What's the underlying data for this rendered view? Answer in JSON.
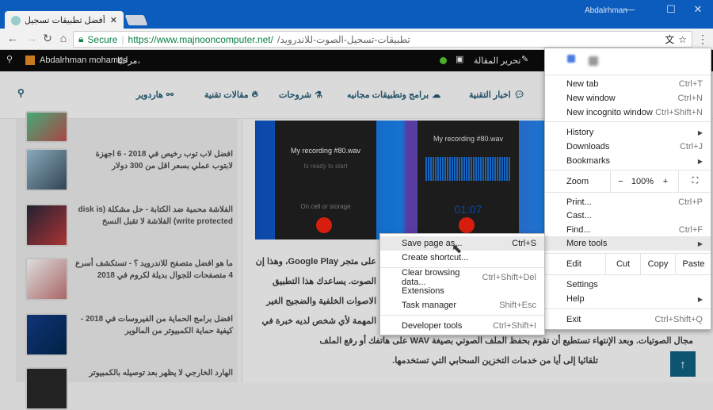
{
  "window": {
    "user": "Abdalrhman",
    "tab_title": "أفضل تطبيقات تسجيل الد..."
  },
  "omnibox": {
    "secure": "Secure",
    "url_host": "https://www.majnooncomputer.net/",
    "url_path": "تطبيقات-تسجيل-الصوت-للاندرويد/"
  },
  "topbar": {
    "user": "Abdalrhman mohamed",
    "greeting": "مرحبًا،",
    "edit_post": "تحرير المقالة"
  },
  "nav": {
    "items": [
      "اخبار التقنية",
      "برامج وتطبيقات مجانيه",
      "شروحات",
      "مقالات تقنية",
      "هاردوير"
    ]
  },
  "sidebar": {
    "posts": [
      "افضل لاب توب رخيص في 2018 - 6 اجهزة لابتوب عملي بسعر اقل من 300 دولار",
      "الفلاشة محمية ضد الكتابة - حل مشكلة (disk is write protected) الفلاشة لا تقبل النسخ",
      "ما هو افضل متصفح للاندرويد ؟ - تستكشف أسرع 4 متصفحات للجوال بديلة لكروم في 2018",
      "افضل برامج الحماية من الفيروسات في 2018 - كيفية حماية الكمبيوتر من المالوير",
      "الهارد الخارجي لا يظهر بعد توصيله بالكمبيوتر"
    ]
  },
  "hero": {
    "recording_name": "My recording #80.wav",
    "status": "Is ready to start",
    "storage": "On cell or storage",
    "timer": "01:07"
  },
  "article": {
    "lines": [
      "على متجر Google Play، وهذا إن",
      "الصوت. يساعدك هذا التطبيق",
      "الاصوات الخلفية والضجيج الغير",
      "المهمة لأي شخص لديه خبرة في",
      "مجال الصوتيات. وبعد الإنتهاء تستطيع أن تقوم بحفظ الملف الصوتي بصيغة WAV على هاتفك أو رفع الملف",
      "تلقائيا إلى أيا من خدمات التخزين السحابي التي تستخدمها."
    ]
  },
  "menu": {
    "new_tab": "New tab",
    "new_tab_sc": "Ctrl+T",
    "new_window": "New window",
    "new_window_sc": "Ctrl+N",
    "incognito": "New incognito window",
    "incognito_sc": "Ctrl+Shift+N",
    "history": "History",
    "downloads": "Downloads",
    "downloads_sc": "Ctrl+J",
    "bookmarks": "Bookmarks",
    "zoom": "Zoom",
    "zoom_minus": "−",
    "zoom_value": "100%",
    "zoom_plus": "+",
    "print": "Print...",
    "print_sc": "Ctrl+P",
    "cast": "Cast...",
    "find": "Find...",
    "find_sc": "Ctrl+F",
    "more_tools": "More tools",
    "edit": "Edit",
    "cut": "Cut",
    "copy": "Copy",
    "paste": "Paste",
    "settings": "Settings",
    "help": "Help",
    "exit": "Exit",
    "exit_sc": "Ctrl+Shift+Q"
  },
  "submenu": {
    "save": "Save page as...",
    "save_sc": "Ctrl+S",
    "shortcut": "Create shortcut...",
    "clear": "Clear browsing data...",
    "clear_sc": "Ctrl+Shift+Del",
    "extensions": "Extensions",
    "task": "Task manager",
    "task_sc": "Shift+Esc",
    "devtools": "Developer tools",
    "devtools_sc": "Ctrl+Shift+I"
  }
}
